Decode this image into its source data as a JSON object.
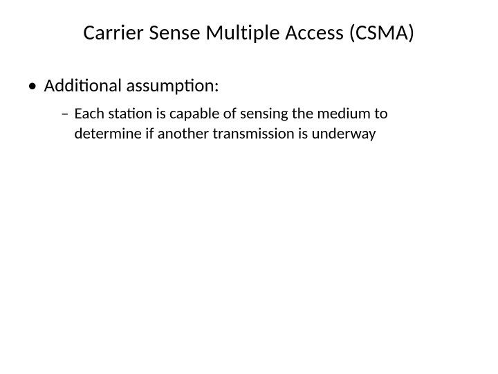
{
  "title": "Carrier Sense Multiple Access (CSMA)",
  "bullets": {
    "level1": {
      "marker": "•",
      "text": "Additional assumption:"
    },
    "level2": {
      "marker": "–",
      "text": "Each station is capable of sensing the medium to determine if another transmission is underway"
    }
  }
}
